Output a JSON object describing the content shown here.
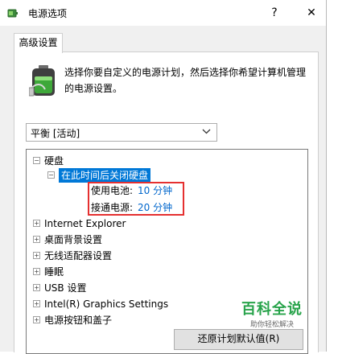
{
  "window": {
    "title": "电源选项",
    "help_glyph": "?",
    "close_glyph": "✕"
  },
  "tab": {
    "label": "高级设置"
  },
  "description": "选择你要自定义的电源计划，然后选择你希望计算机管理的电源设置。",
  "plan_select": {
    "value": "平衡 [活动]"
  },
  "tree": {
    "nodes": [
      {
        "label": "硬盘",
        "expander": "−"
      },
      {
        "label": "在此时间后关闭硬盘",
        "expander": "−"
      },
      {
        "label": "Internet Explorer",
        "expander": "+"
      },
      {
        "label": "桌面背景设置",
        "expander": "+"
      },
      {
        "label": "无线适配器设置",
        "expander": "+"
      },
      {
        "label": "睡眠",
        "expander": "+"
      },
      {
        "label": "USB 设置",
        "expander": "+"
      },
      {
        "label": "Intel(R) Graphics Settings",
        "expander": "+"
      },
      {
        "label": "电源按钮和盖子",
        "expander": "+"
      }
    ],
    "settings": [
      {
        "key": "使用电池:",
        "value": "10 分钟"
      },
      {
        "key": "接通电源:",
        "value": "20 分钟"
      }
    ]
  },
  "restore_button": {
    "label": "还原计划默认值(R)"
  },
  "watermark": {
    "title": "百科全说",
    "subtitle": "助你轻松解决"
  },
  "colors": {
    "selection": "#0078d7",
    "link_value": "#0066cc",
    "highlight_box": "#e53030",
    "watermark": "#27a34a"
  }
}
